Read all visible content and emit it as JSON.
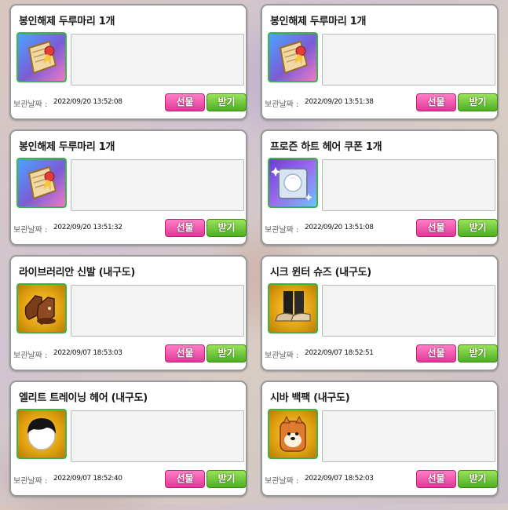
{
  "date_label": "보관날짜 :",
  "buttons": {
    "gift": "선물",
    "receive": "받기"
  },
  "items": [
    {
      "title": "봉인해제 두루마리 1개",
      "date": "2022/09/20 13:52:08",
      "icon": "scroll-icon"
    },
    {
      "title": "봉인해제 두루마리 1개",
      "date": "2022/09/20 13:51:38",
      "icon": "scroll-icon"
    },
    {
      "title": "봉인해제 두루마리 1개",
      "date": "2022/09/20 13:51:32",
      "icon": "scroll-icon"
    },
    {
      "title": "프로즌 하트 헤어 쿠폰 1개",
      "date": "2022/09/20 13:51:08",
      "icon": "hair-coupon-icon"
    },
    {
      "title": "라이브러리안 신발 (내구도)",
      "date": "2022/09/07 18:53:03",
      "icon": "brown-shoes-icon"
    },
    {
      "title": "시크 윈터 슈즈 (내구도)",
      "date": "2022/09/07 18:52:51",
      "icon": "winter-shoes-icon"
    },
    {
      "title": "엘리트 트레이닝 헤어 (내구도)",
      "date": "2022/09/07 18:52:40",
      "icon": "black-hair-icon"
    },
    {
      "title": "시바 백팩 (내구도)",
      "date": "2022/09/07 18:52:03",
      "icon": "shiba-backpack-icon"
    }
  ]
}
